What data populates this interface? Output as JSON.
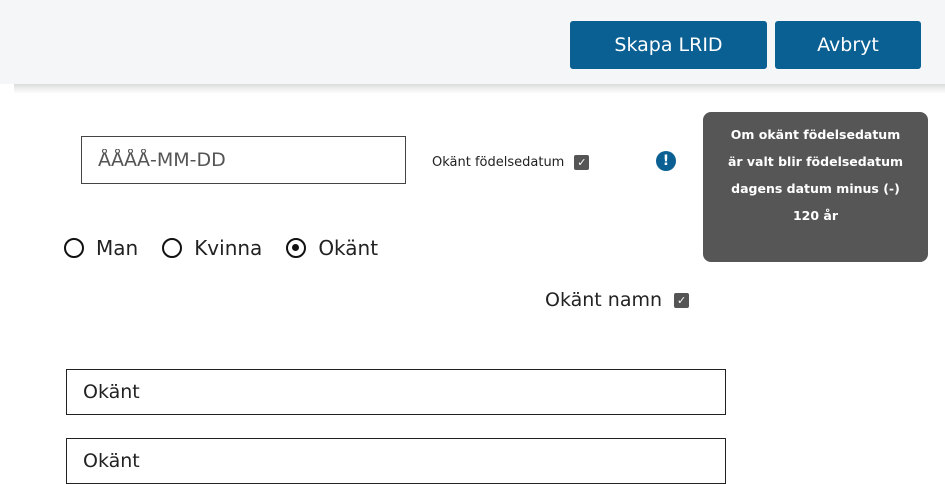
{
  "toolbar": {
    "create_label": "Skapa LRID",
    "cancel_label": "Avbryt",
    "accent_color": "#0a5f93"
  },
  "birthdate": {
    "placeholder": "ÅÅÅÅ-MM-DD",
    "value": "",
    "unknown_label": "Okänt födelsedatum",
    "unknown_checked": true,
    "info_icon": "exclamation-info-icon"
  },
  "tooltip": {
    "lines": [
      "Om okänt födelsedatum",
      "är valt blir födelsedatum",
      "dagens datum minus (-)",
      "120 år"
    ]
  },
  "gender": {
    "options": [
      "Man",
      "Kvinna",
      "Okänt"
    ],
    "selected": "Okänt"
  },
  "name": {
    "unknown_label": "Okänt namn",
    "unknown_checked": true,
    "first_value": "Okänt",
    "last_value": "Okänt"
  }
}
